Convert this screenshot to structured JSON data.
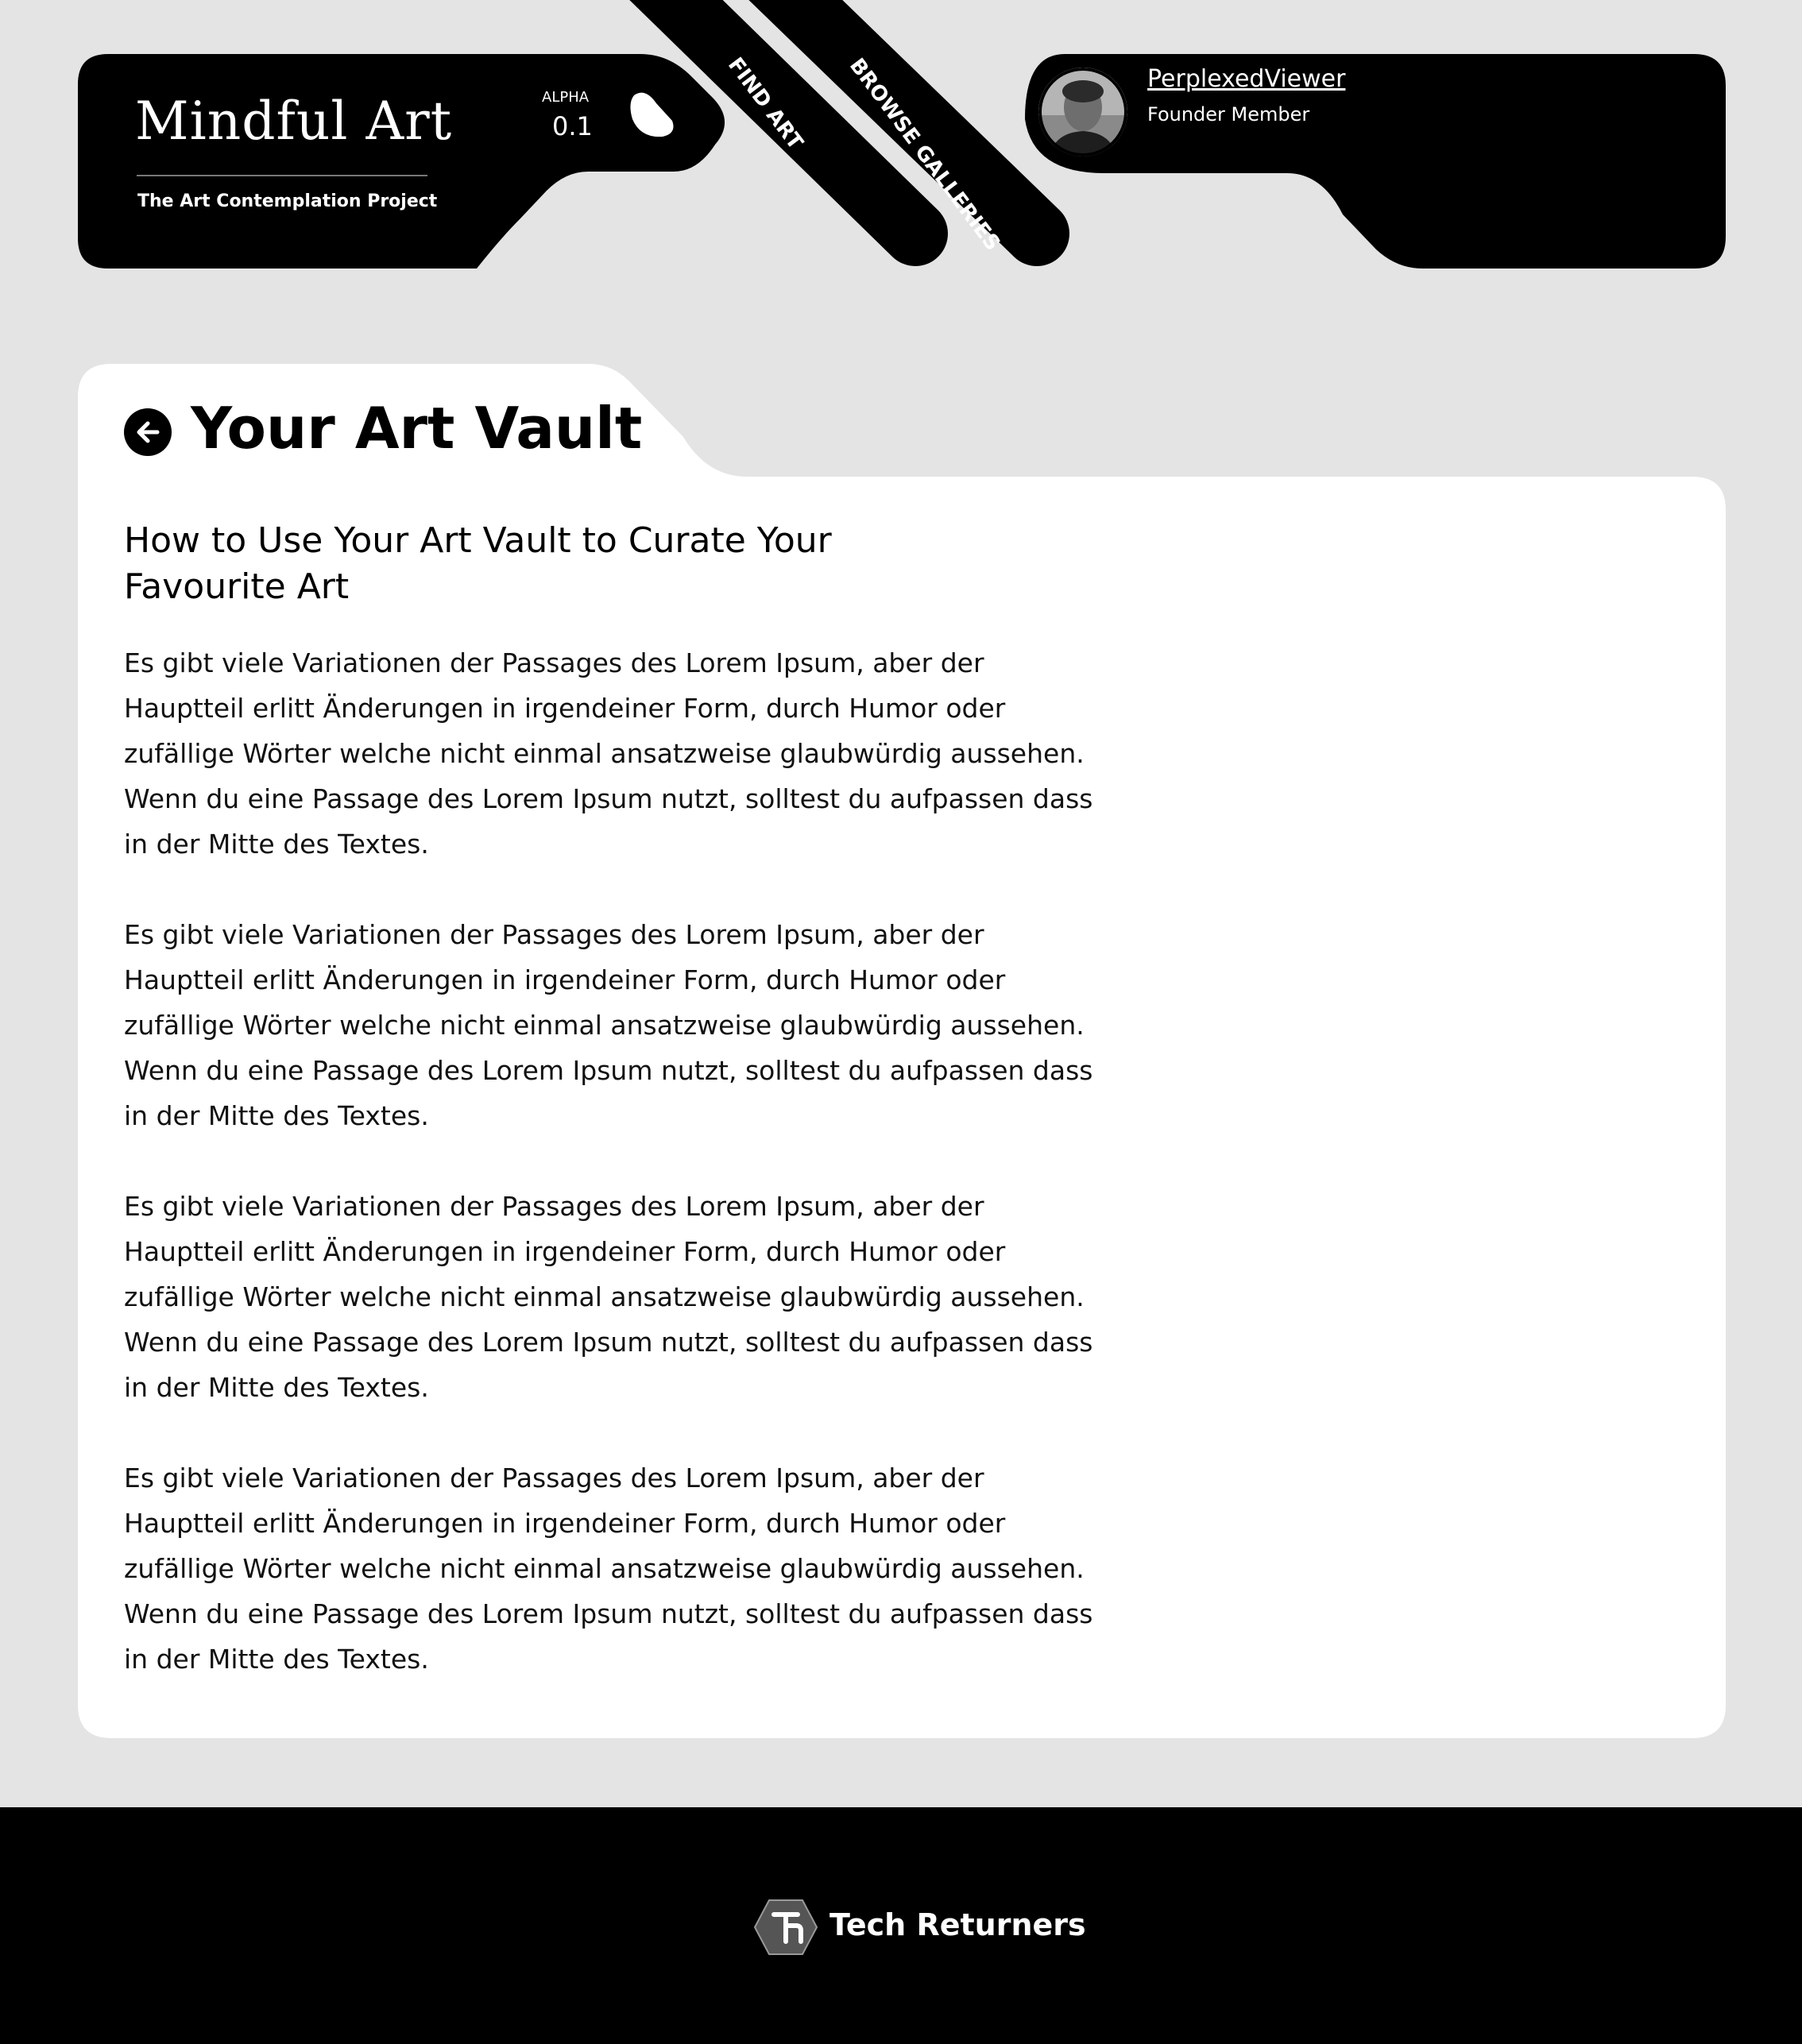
{
  "header": {
    "logo_title": "Mindful Art",
    "logo_subtitle": "The Art Contemplation Project",
    "alpha_label": "ALPHA",
    "version": "0.1",
    "nav": {
      "find_art": "FIND ART",
      "browse_galleries": "BROWSE GALLERIES"
    },
    "user": {
      "username": "PerplexedViewer",
      "role": "Founder Member"
    }
  },
  "main": {
    "page_title": "Your Art Vault",
    "heading": "How to Use Your Art Vault to Curate Your Favourite Art",
    "paragraphs": [
      "Es gibt viele Variationen der Passages des Lorem Ipsum, aber der Hauptteil erlitt Änderungen in irgendeiner Form, durch Humor oder zufällige Wörter welche nicht einmal ansatzweise glaubwürdig aussehen. Wenn du eine Passage des Lorem Ipsum nutzt, solltest du aufpassen dass in der Mitte des Textes.",
      "Es gibt viele Variationen der Passages des Lorem Ipsum, aber der Hauptteil erlitt Änderungen in irgendeiner Form, durch Humor oder zufällige Wörter welche nicht einmal ansatzweise glaubwürdig aussehen. Wenn du eine Passage des Lorem Ipsum nutzt, solltest du aufpassen dass in der Mitte des Textes.",
      "Es gibt viele Variationen der Passages des Lorem Ipsum, aber der Hauptteil erlitt Änderungen in irgendeiner Form, durch Humor oder zufällige Wörter welche nicht einmal ansatzweise glaubwürdig aussehen. Wenn du eine Passage des Lorem Ipsum nutzt, solltest du aufpassen dass in der Mitte des Textes.",
      "Es gibt viele Variationen der Passages des Lorem Ipsum, aber der Hauptteil erlitt Änderungen in irgendeiner Form, durch Humor oder zufällige Wörter welche nicht einmal ansatzweise glaubwürdig aussehen. Wenn du eine Passage des Lorem Ipsum nutzt, solltest du aufpassen dass in der Mitte des Textes."
    ]
  },
  "footer": {
    "brand": "Tech Returners"
  },
  "icons": {
    "back": "arrow-left-circle-icon",
    "logo_mark": "blob-icon",
    "footer_logo": "hexagon-tr-icon"
  },
  "colors": {
    "background": "#e4e4e4",
    "header_bg": "#000000",
    "card_bg": "#ffffff",
    "text": "#000000"
  }
}
